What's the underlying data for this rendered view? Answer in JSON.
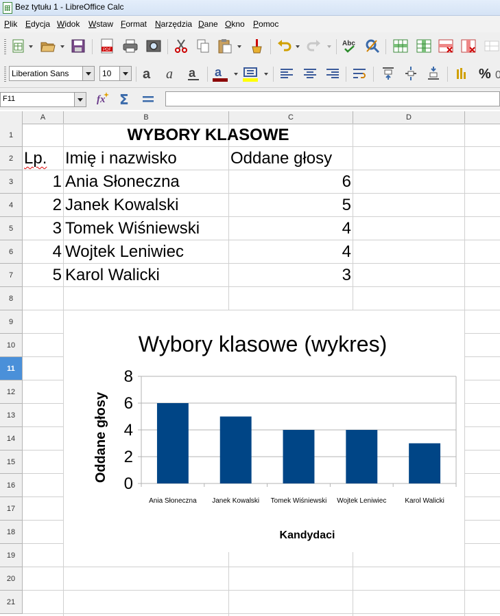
{
  "window": {
    "title": "Bez tytułu 1 - LibreOffice Calc"
  },
  "menu": [
    "Plik",
    "Edycja",
    "Widok",
    "Wstaw",
    "Format",
    "Narzędzia",
    "Dane",
    "Okno",
    "Pomoc"
  ],
  "formatting": {
    "font_name": "Liberation Sans",
    "font_size": "10"
  },
  "formula_bar": {
    "name_box": "F11",
    "formula": ""
  },
  "colors": {
    "accent_font": "#8b0000",
    "highlight": "#ffff00",
    "bar": "#004586"
  },
  "sheet": {
    "columns": [
      "A",
      "B",
      "C",
      "D"
    ],
    "rows": [
      "1",
      "2",
      "3",
      "4",
      "5",
      "6",
      "7",
      "8",
      "9",
      "10",
      "11",
      "12",
      "13",
      "14",
      "15",
      "16",
      "17",
      "18",
      "19",
      "20",
      "21"
    ],
    "selected_row": "11",
    "title": "WYBORY KLASOWE",
    "headers": {
      "lp": "Lp.",
      "name": "Imię i nazwisko",
      "votes": "Oddane głosy"
    },
    "records": [
      {
        "lp": "1",
        "name": "Ania Słoneczna",
        "votes": "6"
      },
      {
        "lp": "2",
        "name": "Janek Kowalski",
        "votes": "5"
      },
      {
        "lp": "3",
        "name": "Tomek Wiśniewski",
        "votes": "4"
      },
      {
        "lp": "4",
        "name": "Wojtek Leniwiec",
        "votes": "4"
      },
      {
        "lp": "5",
        "name": "Karol Walicki",
        "votes": "3"
      }
    ]
  },
  "chart_data": {
    "type": "bar",
    "title": "Wybory klasowe (wykres)",
    "xlabel": "Kandydaci",
    "ylabel": "Oddane głosy",
    "categories": [
      "Ania Słoneczna",
      "Janek Kowalski",
      "Tomek Wiśniewski",
      "Wojtek Leniwiec",
      "Karol Walicki"
    ],
    "values": [
      6,
      5,
      4,
      4,
      3
    ],
    "ylim": [
      0,
      8
    ],
    "yticks": [
      "0",
      "2",
      "4",
      "6",
      "8"
    ],
    "grid": true,
    "legend": "none"
  }
}
